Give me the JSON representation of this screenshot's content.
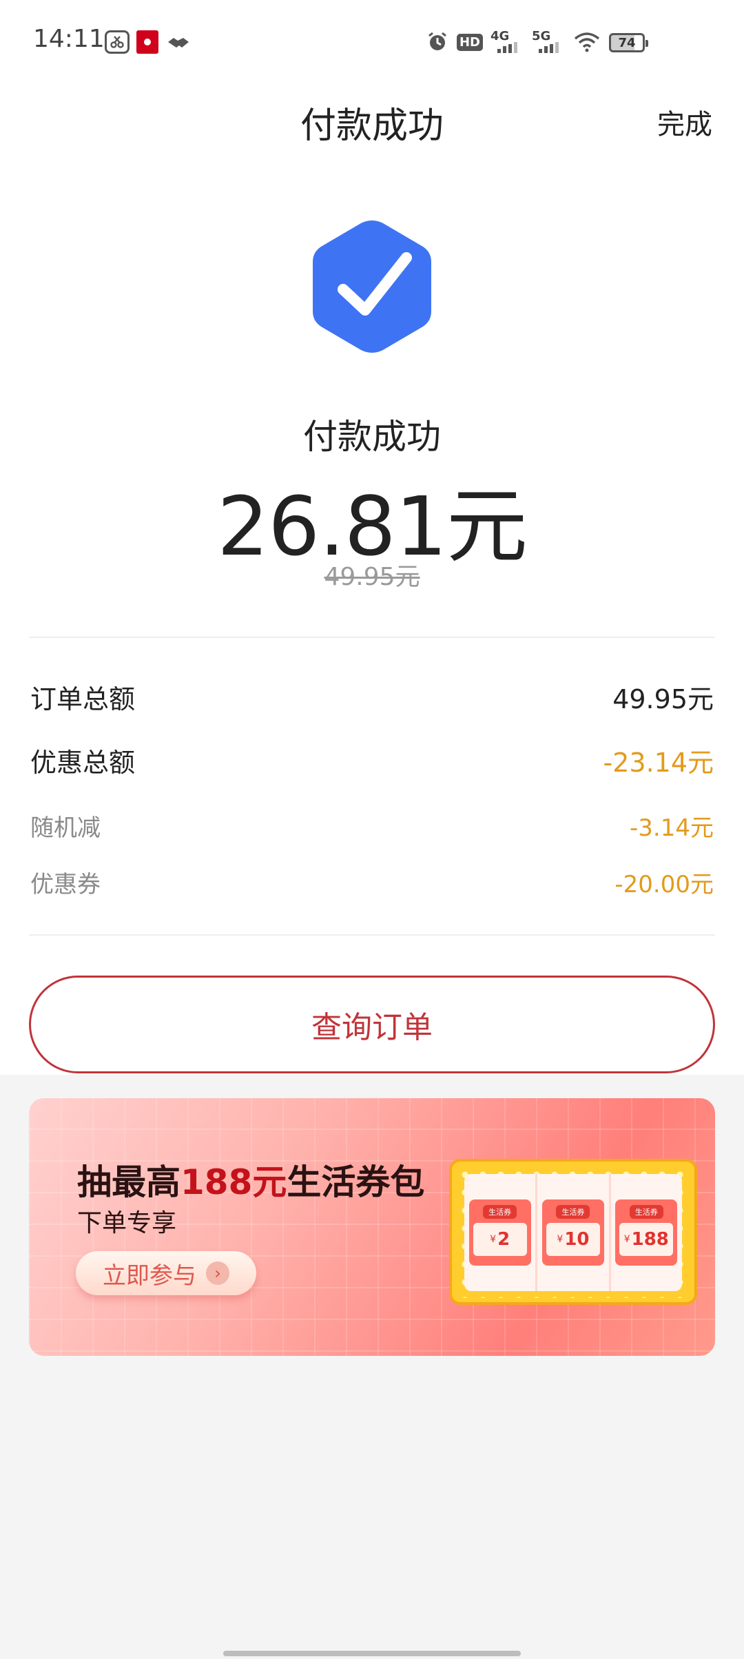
{
  "status_bar": {
    "time": "14:11",
    "network_1": "4G",
    "network_2": "5G",
    "hd_label": "HD",
    "battery": "74",
    "icons": [
      "scissors-app-icon",
      "red-app-icon",
      "handshake-icon",
      "alarm-icon",
      "hd-icon",
      "signal-4g-icon",
      "signal-5g-icon",
      "wifi-icon",
      "battery-icon"
    ]
  },
  "header": {
    "title": "付款成功",
    "done_label": "完成"
  },
  "result": {
    "status_text": "付款成功",
    "amount_paid": "26.81元",
    "amount_original": "49.95元",
    "badge_color": "#3e74f3"
  },
  "summary": {
    "order_total_label": "订单总额",
    "order_total_value": "49.95元",
    "discount_total_label": "优惠总额",
    "discount_total_value": "-23.14元",
    "random_discount_label": "随机减",
    "random_discount_value": "-3.14元",
    "coupon_label": "优惠券",
    "coupon_value": "-20.00元"
  },
  "actions": {
    "query_order_label": "查询订单"
  },
  "promo": {
    "title_prefix": "抽最高",
    "title_amount": "188元",
    "title_suffix": "生活券包",
    "subtitle": "下单专享",
    "join_label": "立即参与",
    "coupons": [
      {
        "tag": "生活券",
        "yen": "¥",
        "value": "2"
      },
      {
        "tag": "生活券",
        "yen": "¥",
        "value": "10"
      },
      {
        "tag": "生活券",
        "yen": "¥",
        "value": "188"
      }
    ]
  },
  "colors": {
    "accent_red": "#c0343a",
    "discount_orange": "#e39a1b",
    "badge_blue": "#3e74f3"
  }
}
